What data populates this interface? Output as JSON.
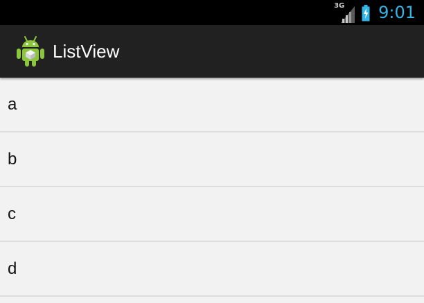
{
  "status_bar": {
    "network_type": "3G",
    "time": "9:01",
    "icons": [
      "signal-icon",
      "battery-charging-icon"
    ]
  },
  "action_bar": {
    "app_icon": "android-icon",
    "title": "ListView"
  },
  "list": {
    "items": [
      "a",
      "b",
      "c",
      "d"
    ]
  },
  "colors": {
    "status_bar_bg": "#000000",
    "clock": "#33b5e5",
    "action_bar_bg": "#212121",
    "list_bg": "#f2f2f2",
    "divider": "#dcdcdc",
    "android_green": "#8cc63f"
  }
}
